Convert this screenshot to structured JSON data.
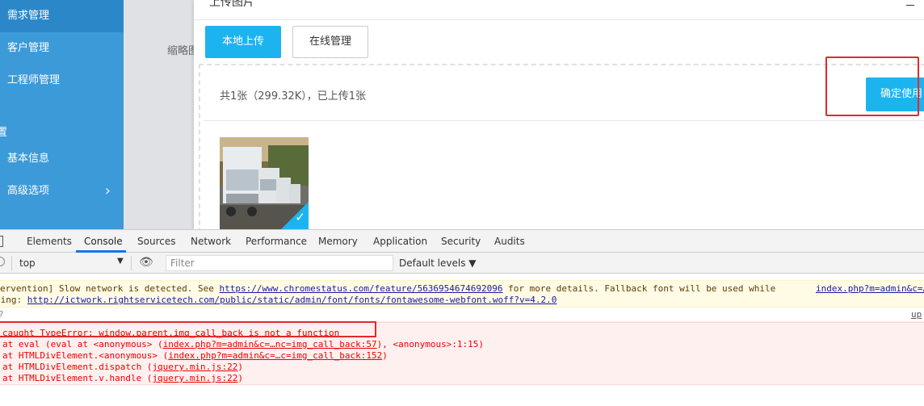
{
  "sidebar": {
    "items": [
      {
        "label": "需求管理"
      },
      {
        "label": "客户管理"
      },
      {
        "label": "工程师管理"
      },
      {
        "label": "基本信息"
      },
      {
        "label": "高级选项"
      }
    ],
    "group_label": "置"
  },
  "content": {
    "thumb_label": "缩略图"
  },
  "modal": {
    "title": "上传图片",
    "local_upload": "本地上传",
    "online_manage": "在线管理",
    "summary": "共1张（299.32K），已上传1张",
    "confirm": "确定使用"
  },
  "devtools": {
    "tabs": [
      "Elements",
      "Console",
      "Sources",
      "Network",
      "Performance",
      "Memory",
      "Application",
      "Security",
      "Audits"
    ],
    "context": "top",
    "filter_placeholder": "Filter",
    "levels": "Default levels ▼",
    "warn": {
      "l1_prefix": "ervention] Slow network is detected. See ",
      "l1_link": "https://www.chromestatus.com/feature/5636954674692096",
      "l1_suffix": " for more details. Fallback font will be used while",
      "l2_prefix": "ding: ",
      "l2_link": "http://ictwork.rightservicetech.com/public/static/admin/font/fonts/fontawesome-webfont.woff?v=4.2.0",
      "src": "index.php?m=admin&c=…"
    },
    "plain_src": "up",
    "error": {
      "message": "caught TypeError: window.parent.img_call_back is not a function",
      "line1_prefix": "at eval (eval at <anonymous> (",
      "line1_link": "index.php?m=admin&c=…nc=img_call_back:57",
      "line1_suffix": "), <anonymous>:1:15)",
      "line2_prefix": "at HTMLDivElement.<anonymous> (",
      "line2_link": "index.php?m=admin&c=…c=img_call_back:152",
      "line2_suffix": ")",
      "line3_prefix": "at HTMLDivElement.dispatch (",
      "line3_link": "jquery.min.js:22",
      "line3_suffix": ")",
      "line4_prefix": "at HTMLDivElement.v.handle (",
      "line4_link": "jquery.min.js:22",
      "line4_suffix": ")"
    }
  },
  "colors": {
    "accent": "#1cb4ef",
    "sidebar": "#3d9ad8",
    "highlight_red": "#e4292b"
  }
}
